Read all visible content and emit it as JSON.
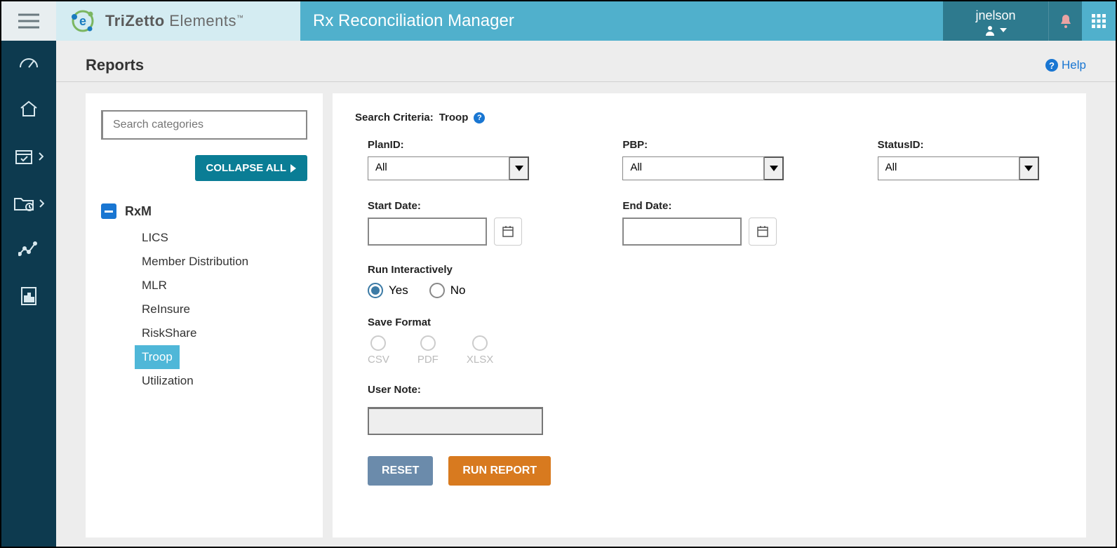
{
  "brand": {
    "part1": "Tri",
    "part2": "Zetto",
    "suffix": " Elements",
    "tm": "™"
  },
  "app_title": "Rx Reconciliation Manager",
  "user": {
    "name": "jnelson"
  },
  "page": {
    "title": "Reports",
    "help": "Help"
  },
  "sidebar": {
    "search_placeholder": "Search categories",
    "collapse_label": "COLLAPSE ALL",
    "root_label": "RxM",
    "items": [
      {
        "label": "LICS",
        "active": false
      },
      {
        "label": "Member Distribution",
        "active": false
      },
      {
        "label": "MLR",
        "active": false
      },
      {
        "label": "ReInsure",
        "active": false
      },
      {
        "label": "RiskShare",
        "active": false
      },
      {
        "label": "Troop",
        "active": true
      },
      {
        "label": "Utilization",
        "active": false
      }
    ]
  },
  "criteria": {
    "title_prefix": "Search Criteria: ",
    "title_value": "Troop",
    "fields": {
      "planid": {
        "label": "PlanID:",
        "value": "All"
      },
      "pbp": {
        "label": "PBP:",
        "value": "All"
      },
      "status": {
        "label": "StatusID:",
        "value": "All"
      },
      "start": {
        "label": "Start Date:",
        "value": ""
      },
      "end": {
        "label": "End Date:",
        "value": ""
      }
    },
    "run_interactively": {
      "label": "Run Interactively",
      "options": {
        "yes": "Yes",
        "no": "No"
      },
      "selected": "yes"
    },
    "save_format": {
      "label": "Save Format",
      "options": {
        "csv": "CSV",
        "pdf": "PDF",
        "xlsx": "XLSX"
      },
      "enabled": false
    },
    "user_note": {
      "label": "User Note:",
      "value": ""
    },
    "buttons": {
      "reset": "RESET",
      "run": "RUN REPORT"
    }
  }
}
